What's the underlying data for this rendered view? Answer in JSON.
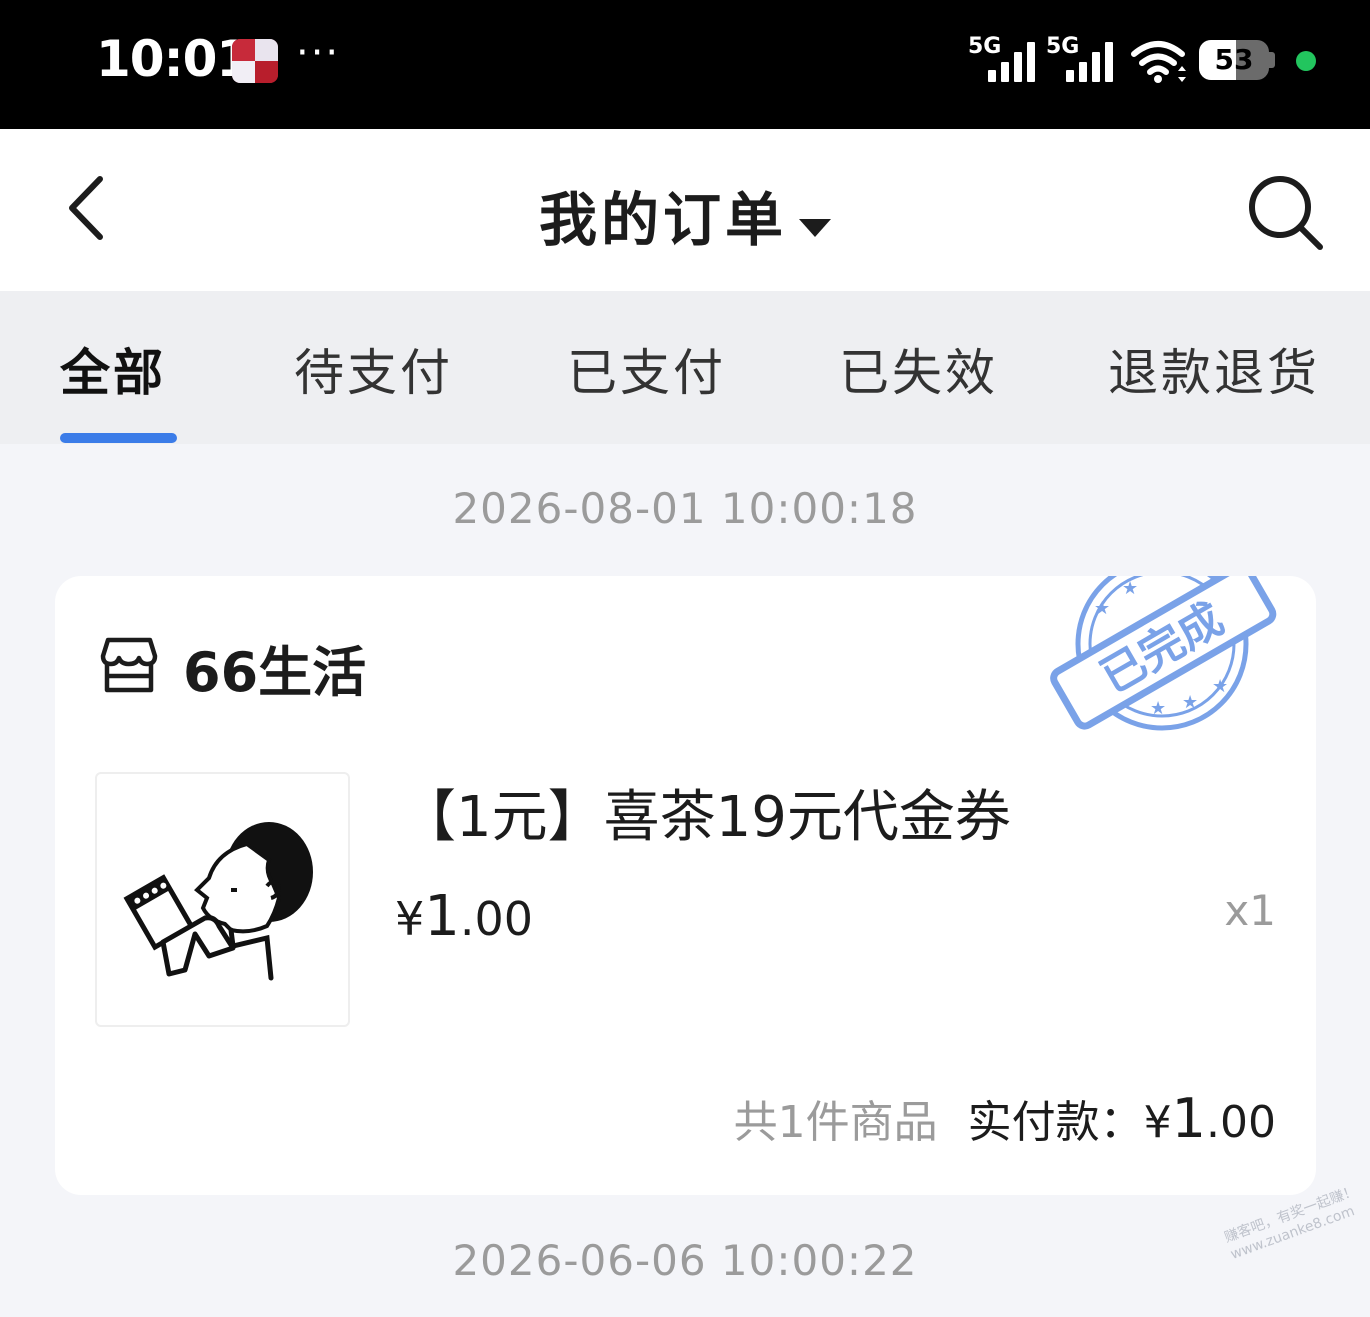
{
  "status_bar": {
    "time": "10:01",
    "app_icon": "news-app-icon",
    "more": "···",
    "sim1_label": "5G",
    "sim2_label": "5G",
    "battery": "53",
    "battery_level": 0.53,
    "dot_color": "#22c55e"
  },
  "header": {
    "title": "我的订单",
    "back_icon": "chevron-left-icon",
    "caret_icon": "caret-down-icon",
    "search_icon": "search-icon"
  },
  "tabs": [
    {
      "label": "全部",
      "active": true
    },
    {
      "label": "待支付",
      "active": false
    },
    {
      "label": "已支付",
      "active": false
    },
    {
      "label": "已失效",
      "active": false
    },
    {
      "label": "退款退货",
      "active": false
    }
  ],
  "accent_color": "#3b7ce8",
  "orders": [
    {
      "date": "2026-08-01 10:00:18",
      "store": "66生活",
      "status_stamp": "已完成",
      "product": {
        "name": "【1元】喜茶19元代金券",
        "price_symbol": "¥",
        "price_int": "1",
        "price_dec": ".00",
        "qty": "x1"
      },
      "count_text": "共1件商品",
      "paid_label": "实付款：",
      "paid_symbol": "¥",
      "paid_int": "1",
      "paid_dec": ".00"
    }
  ],
  "next_date": "2026-06-06 10:00:22",
  "watermark": {
    "line1": "赚客吧，有奖一起赚！",
    "line2": "www.zuanke8.com"
  }
}
